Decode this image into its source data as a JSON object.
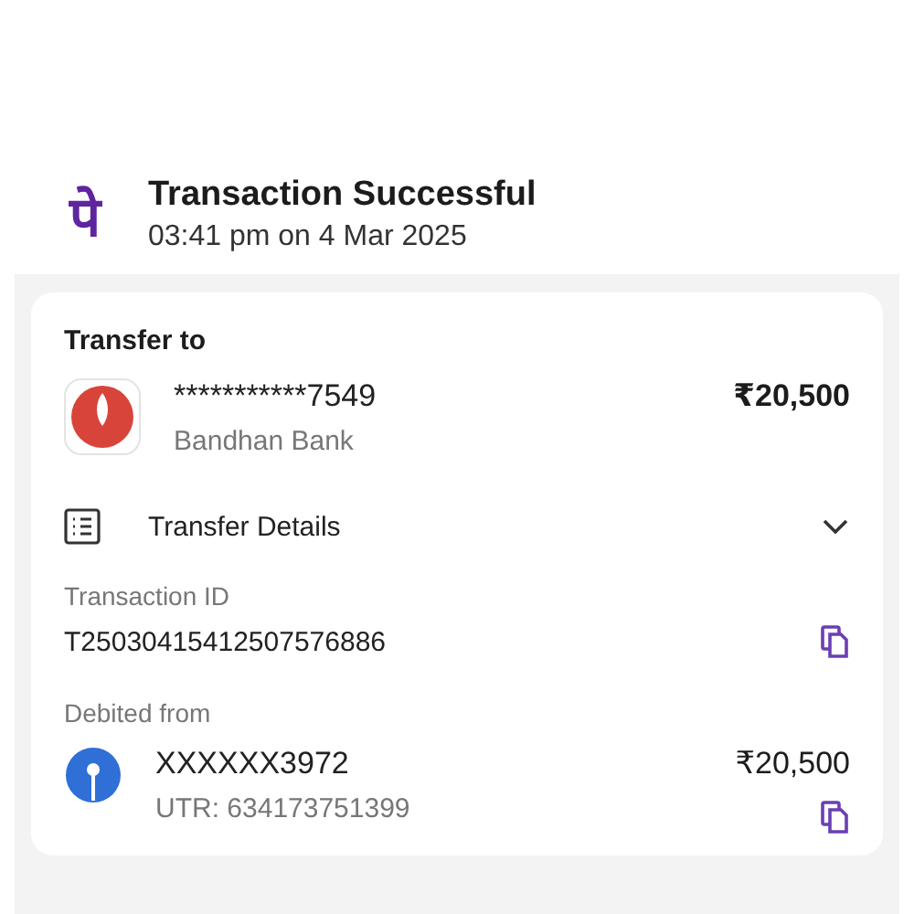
{
  "header": {
    "logo": "पे",
    "title": "Transaction Successful",
    "timestamp": "03:41 pm on 4 Mar 2025"
  },
  "card": {
    "transfer_to": {
      "heading": "Transfer to",
      "account": "***********7549",
      "bank": "Bandhan Bank",
      "amount": "₹20,500"
    },
    "details": {
      "label": "Transfer Details",
      "expanded": false
    },
    "transaction": {
      "label": "Transaction ID",
      "value": "T25030415412507576886"
    },
    "debited_from": {
      "heading": "Debited from",
      "account": "XXXXXX3972",
      "utr": "UTR: 634173751399",
      "amount": "₹20,500"
    }
  }
}
